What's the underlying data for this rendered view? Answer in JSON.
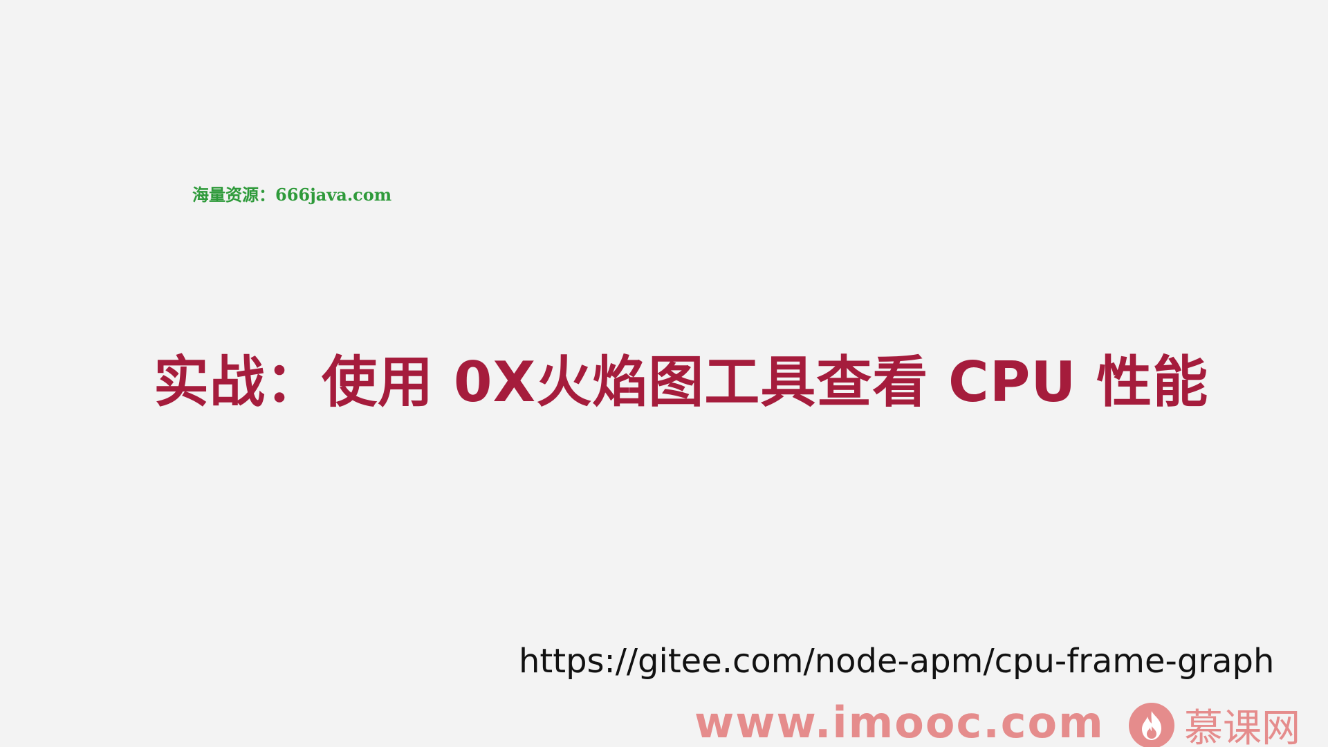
{
  "watermark": {
    "text": "海量资源：666java.com"
  },
  "slide": {
    "title": "实战：使用 0X火焰图工具查看 CPU 性能",
    "url": "https://gitee.com/node-apm/cpu-frame-graph"
  },
  "footer": {
    "site": "www.imooc.com",
    "brand_text": "慕课网",
    "brand_icon": "flame-logo-icon"
  },
  "colors": {
    "background": "#f3f3f3",
    "title": "#a51c3c",
    "watermark": "#2e9a3a",
    "footer": "#e58c8c",
    "url": "#111111"
  }
}
